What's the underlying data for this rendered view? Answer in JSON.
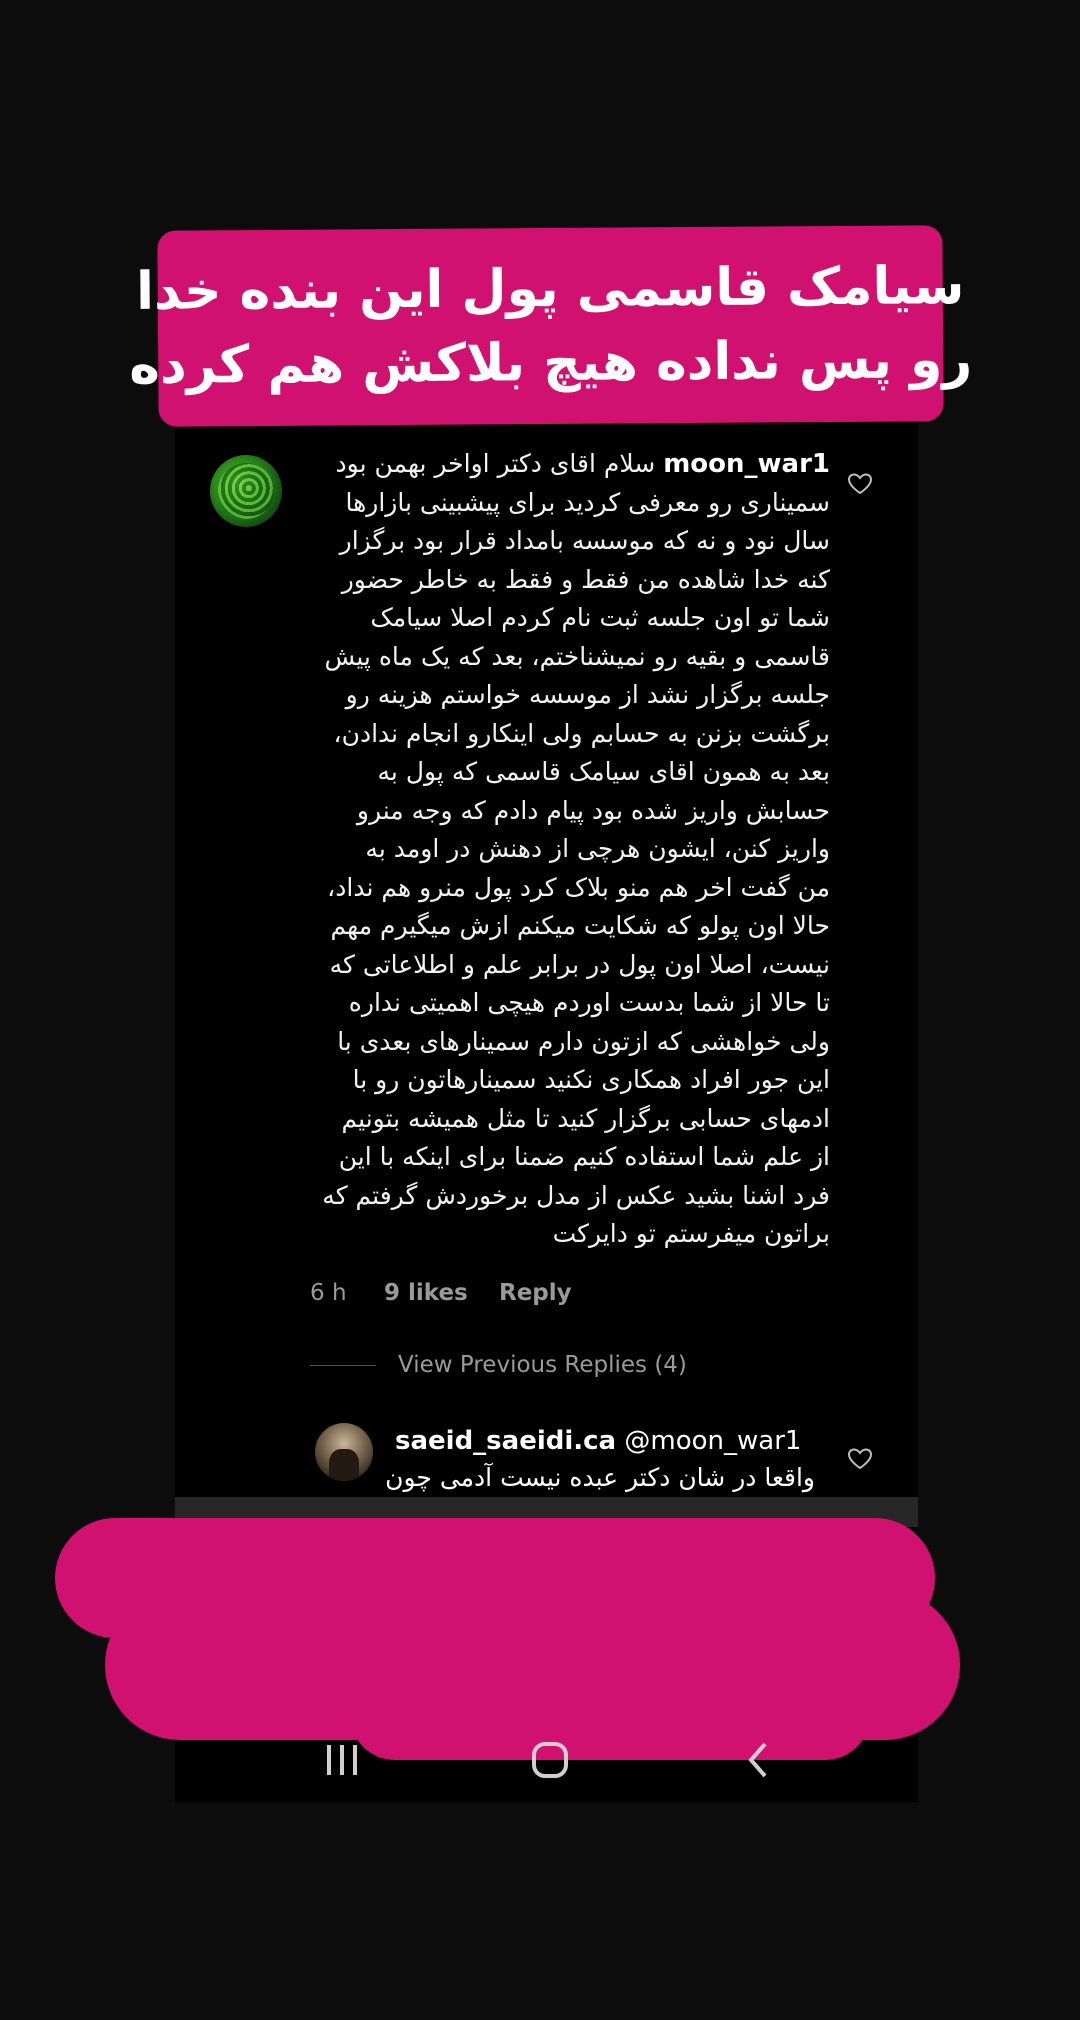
{
  "banner": {
    "lines": [
      "سیامک قاسمی پول این بنده خدا",
      "رو پس نداده هیچ بلاکش هم کرده"
    ]
  },
  "comment": {
    "username": "moon_war1",
    "lines": [
      "سلام اقای دکتر اواخر بهمن بود",
      "سمیناری رو معرفی کردید برای پیشبینی بازارها",
      "سال نود و نه که موسسه بامداد قرار بود برگزار",
      "کنه خدا شاهده من فقط و فقط به خاطر حضور",
      "شما تو اون جلسه ثبت نام کردم اصلا سیامک",
      "قاسمی و بقیه رو نمیشناختم، بعد که یک ماه پیش",
      "جلسه برگزار نشد از موسسه خواستم هزینه رو",
      "برگشت بزنن به حسابم ولی اینکارو انجام ندادن،",
      "بعد به همون اقای سیامک  قاسمی که پول به",
      "حسابش واریز شده بود پیام دادم که وجه منرو",
      "واریز کنن، ایشون هرچی از  دهنش در اومد به",
      "من گفت اخر هم منو بلاک کرد پول منرو هم نداد،",
      "حالا اون پولو که شکایت میکنم ازش میگیرم مهم",
      "نیست، اصلا اون پول در برابر علم و اطلاعاتی که",
      "تا حالا از شما بدست اوردم هیچی اهمیتی نداره",
      "ولی خواهشی که ازتون دارم سمینارهای بعدی با",
      "این جور افراد همکاری نکنید سمینارهاتون رو با",
      "ادمهای حسابی برگزار کنید تا مثل همیشه بتونیم",
      "از علم شما استفاده کنیم ضمنا برای اینکه با این",
      "فرد اشنا بشید عکس از مدل برخوردش گرفتم که",
      "براتون میفرستم تو دایرکت"
    ],
    "time": "6 h",
    "likes": "9 likes",
    "reply_label": "Reply"
  },
  "view_previous": "View Previous Replies (4)",
  "reply": {
    "username": "saeid_saeidi.ca",
    "mention": "@moon_war1",
    "text": "واقعا در شان دکتر عبده نیست آدمی چون"
  },
  "icons": {
    "heart": "heart-outline-icon",
    "nav_recent": "recent-apps-icon",
    "nav_home": "home-icon",
    "nav_back": "back-icon"
  },
  "colors": {
    "accent": "#d1116f",
    "background": "#000000",
    "secondary_text": "#9a9a9a"
  }
}
